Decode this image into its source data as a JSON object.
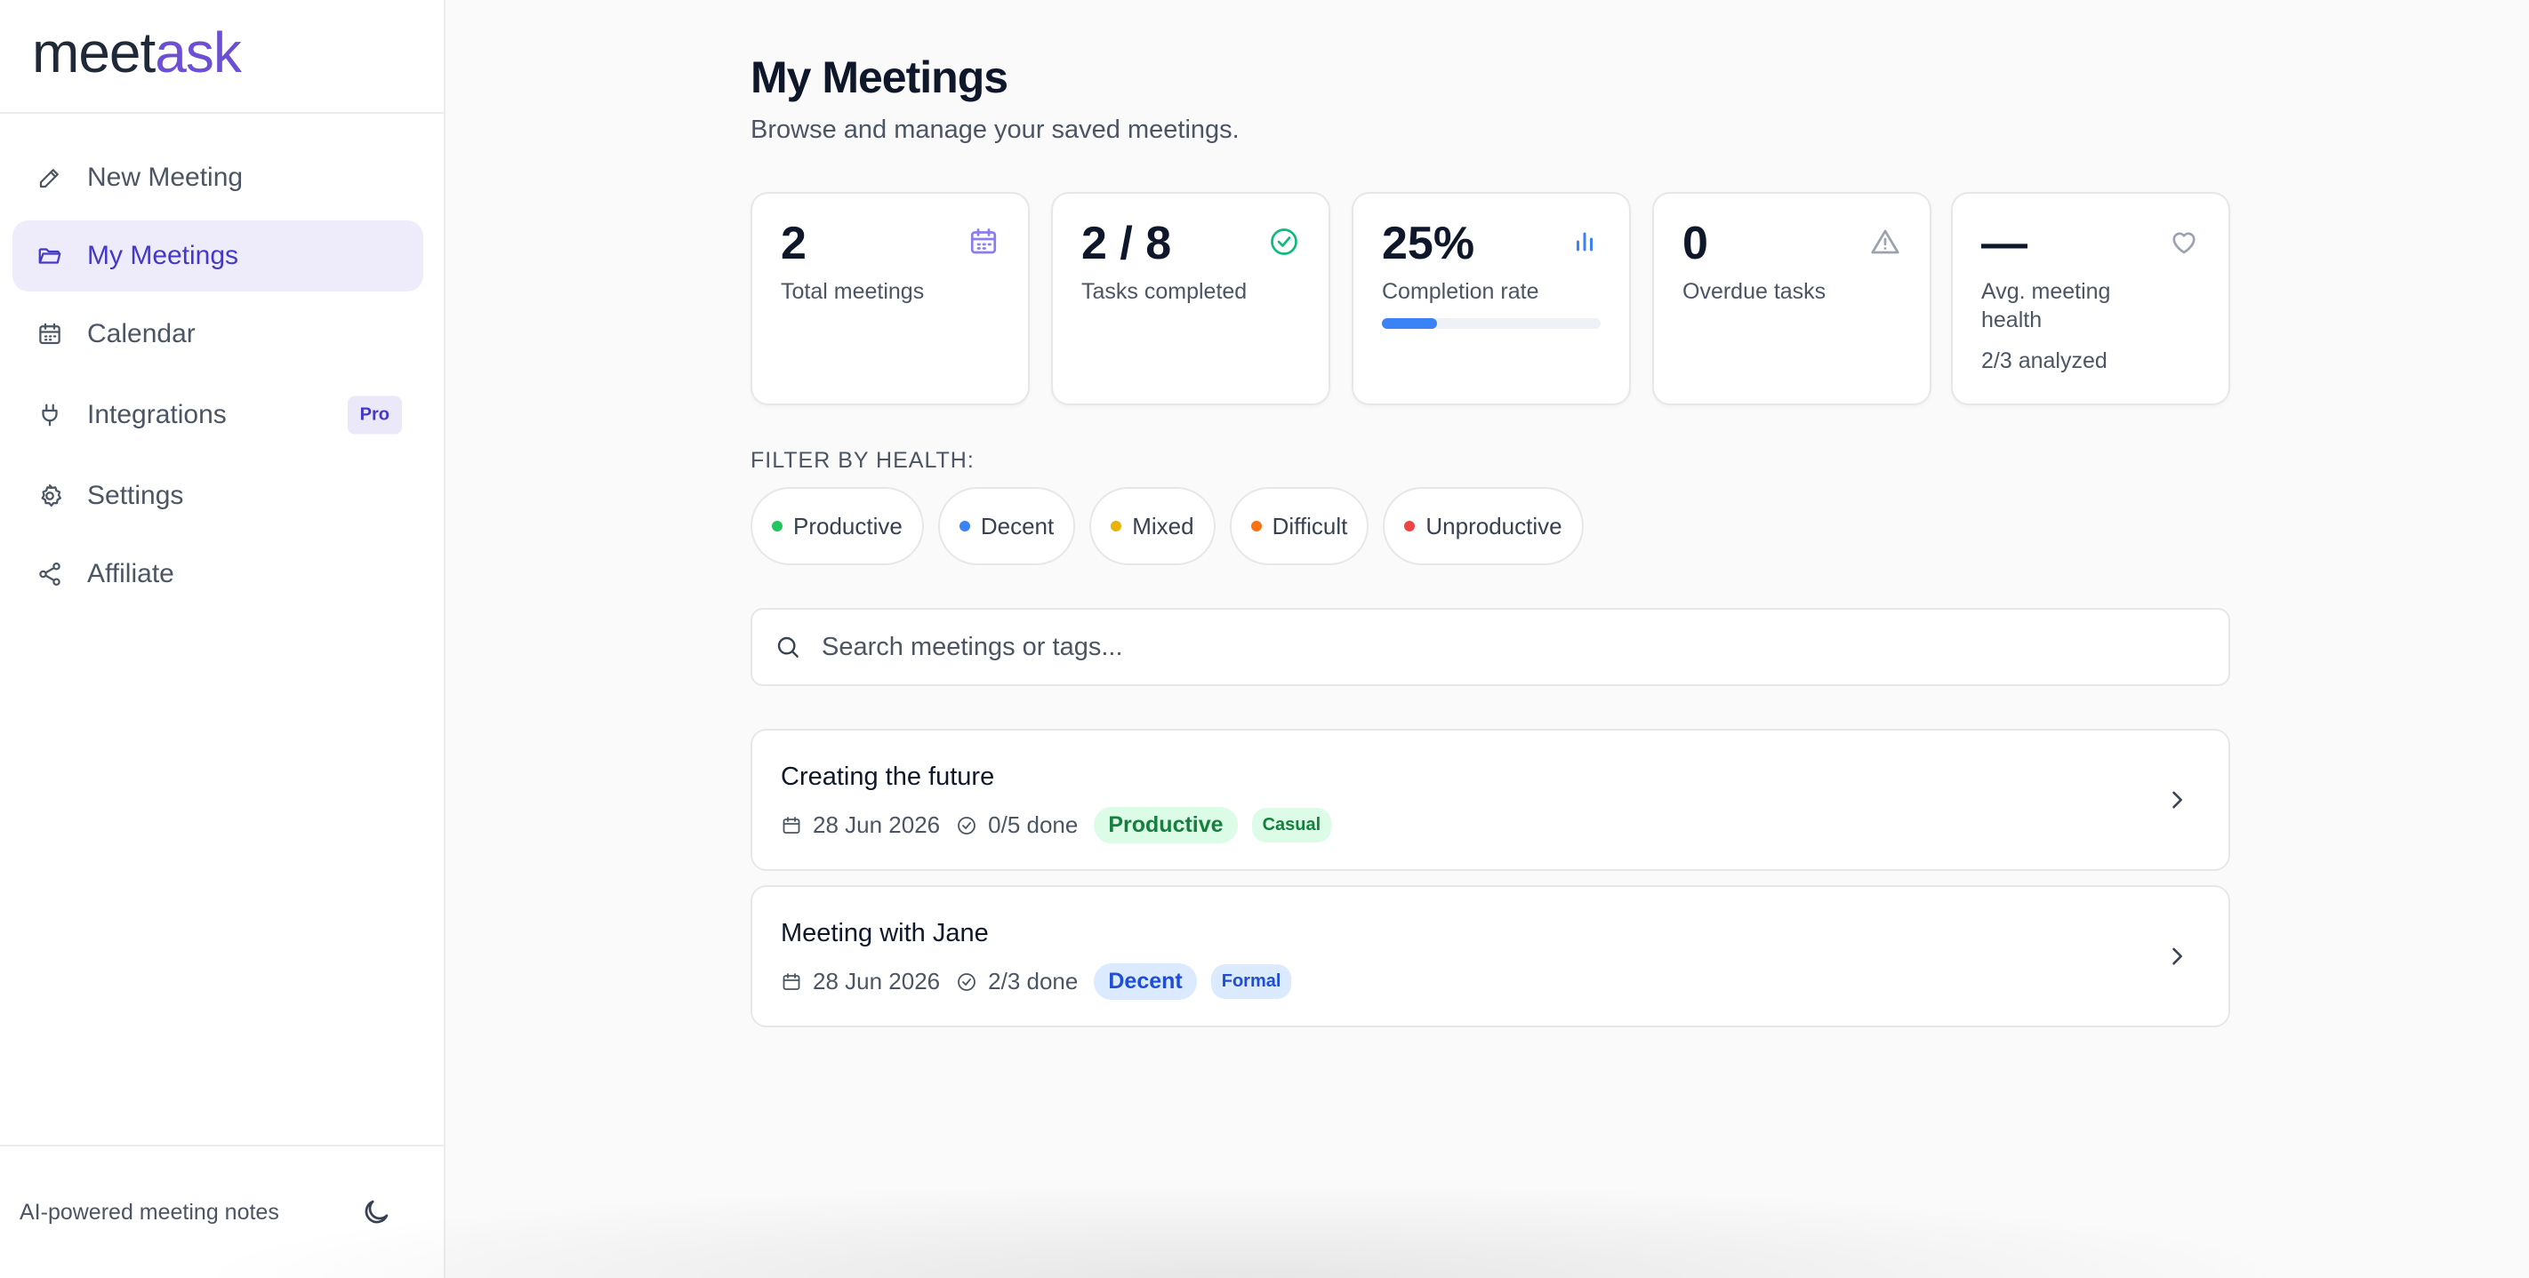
{
  "app": {
    "logo_prefix": "meet",
    "logo_accent": "ask",
    "brand_color": "#6d4fd4"
  },
  "sidebar": {
    "items": [
      {
        "label": "New Meeting",
        "icon": "pencil-icon",
        "active": false
      },
      {
        "label": "My Meetings",
        "icon": "folder-icon",
        "active": true
      },
      {
        "label": "Calendar",
        "icon": "calendar-icon",
        "active": false
      },
      {
        "label": "Integrations",
        "icon": "plug-icon",
        "active": false,
        "badge": "Pro"
      },
      {
        "label": "Settings",
        "icon": "gear-icon",
        "active": false
      },
      {
        "label": "Affiliate",
        "icon": "share-icon",
        "active": false
      }
    ],
    "footer_text": "AI-powered meeting notes",
    "theme_icon": "moon-icon"
  },
  "main": {
    "title": "My Meetings",
    "subtitle": "Browse and manage your saved meetings.",
    "stats": [
      {
        "value": "2",
        "label": "Total meetings",
        "icon": "calendar-icon",
        "icon_color": "#8b7cf0"
      },
      {
        "value": "2 / 8",
        "label": "Tasks completed",
        "icon": "check-circle-icon",
        "icon_color": "#10b981"
      },
      {
        "value": "25%",
        "label": "Completion rate",
        "icon": "bar-chart-icon",
        "icon_color": "#3b82f6",
        "progress": 0.25
      },
      {
        "value": "0",
        "label": "Overdue tasks",
        "icon": "warning-icon",
        "icon_color": "#9ca3af"
      },
      {
        "value": "—",
        "label": "Avg. meeting health",
        "sub": "2/3 analyzed",
        "icon": "heart-icon",
        "icon_color": "#9ca3af"
      }
    ],
    "filter_label": "FILTER BY HEALTH:",
    "filters": [
      {
        "label": "Productive",
        "color": "#22c55e"
      },
      {
        "label": "Decent",
        "color": "#3b82f6"
      },
      {
        "label": "Mixed",
        "color": "#eab308"
      },
      {
        "label": "Difficult",
        "color": "#f97316"
      },
      {
        "label": "Unproductive",
        "color": "#ef4444"
      }
    ],
    "search": {
      "placeholder": "Search meetings or tags...",
      "value": ""
    },
    "meetings": [
      {
        "title": "Creating the future",
        "date": "28 Jun 2026",
        "done": "0/5 done",
        "health": "Productive",
        "health_bg": "#dcfce7",
        "health_fg": "#15803d",
        "tone": "Casual",
        "tone_bg": "#dcfce7",
        "tone_fg": "#15803d"
      },
      {
        "title": "Meeting with Jane",
        "date": "28 Jun 2026",
        "done": "2/3 done",
        "health": "Decent",
        "health_bg": "#dbeafe",
        "health_fg": "#1d4ed8",
        "tone": "Formal",
        "tone_bg": "#dbeafe",
        "tone_fg": "#1d4ed8"
      }
    ]
  }
}
